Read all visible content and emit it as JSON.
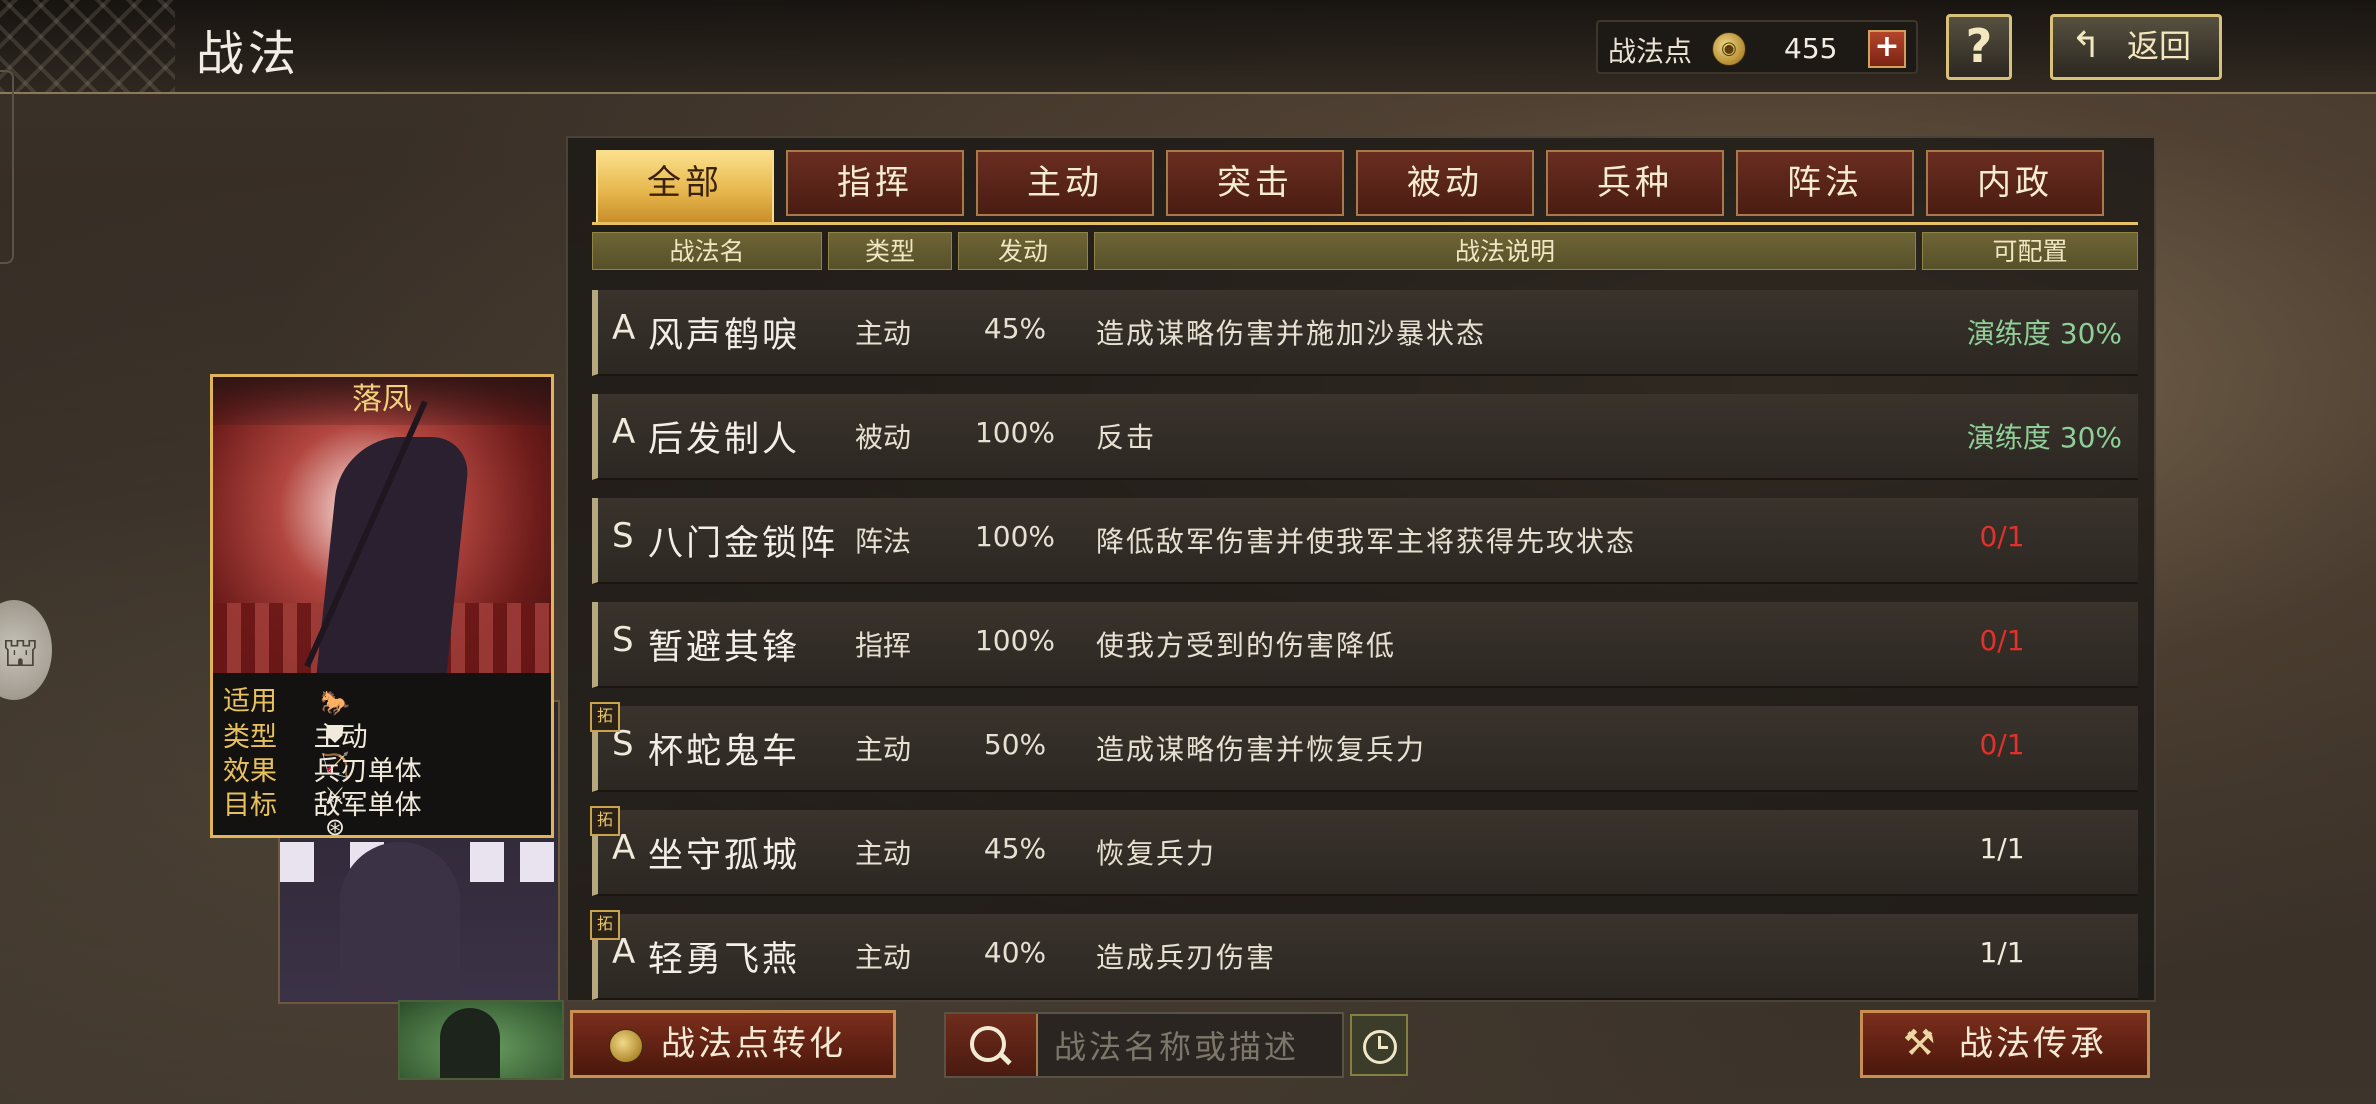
{
  "header": {
    "title": "战法",
    "points_label": "战法点",
    "points_value": "455",
    "plus_label": "+",
    "help_label": "?",
    "back_label": "返回"
  },
  "tabs": [
    {
      "label": "全部",
      "active": true
    },
    {
      "label": "指挥",
      "active": false
    },
    {
      "label": "主动",
      "active": false
    },
    {
      "label": "突击",
      "active": false
    },
    {
      "label": "被动",
      "active": false
    },
    {
      "label": "兵种",
      "active": false
    },
    {
      "label": "阵法",
      "active": false
    },
    {
      "label": "内政",
      "active": false
    }
  ],
  "columns": {
    "name": "战法名",
    "type": "类型",
    "rate": "发动",
    "desc": "战法说明",
    "config": "可配置"
  },
  "skills": [
    {
      "grade": "A",
      "name": "风声鹤唳",
      "type": "主动",
      "rate": "45%",
      "desc": "造成谋略伤害并施加沙暴状态",
      "config": "演练度 30%",
      "config_color": "green",
      "expand": ""
    },
    {
      "grade": "A",
      "name": "后发制人",
      "type": "被动",
      "rate": "100%",
      "desc": "反击",
      "config": "演练度 30%",
      "config_color": "green",
      "expand": ""
    },
    {
      "grade": "S",
      "name": "八门金锁阵",
      "type": "阵法",
      "rate": "100%",
      "desc": "降低敌军伤害并使我军主将获得先攻状态",
      "config": "0/1",
      "config_color": "red",
      "expand": ""
    },
    {
      "grade": "S",
      "name": "暂避其锋",
      "type": "指挥",
      "rate": "100%",
      "desc": "使我方受到的伤害降低",
      "config": "0/1",
      "config_color": "red",
      "expand": ""
    },
    {
      "grade": "S",
      "name": "杯蛇鬼车",
      "type": "主动",
      "rate": "50%",
      "desc": "造成谋略伤害并恢复兵力",
      "config": "0/1",
      "config_color": "red",
      "expand": "拓"
    },
    {
      "grade": "A",
      "name": "坐守孤城",
      "type": "主动",
      "rate": "45%",
      "desc": "恢复兵力",
      "config": "1/1",
      "config_color": "white",
      "expand": "拓"
    },
    {
      "grade": "A",
      "name": "轻勇飞燕",
      "type": "主动",
      "rate": "40%",
      "desc": "造成兵刃伤害",
      "config": "1/1",
      "config_color": "white",
      "expand": "拓"
    }
  ],
  "card": {
    "name": "落凤",
    "apply_label": "适用",
    "type_label": "类型",
    "type_value": "主动",
    "effect_label": "效果",
    "effect_value": "兵刃单体",
    "target_label": "目标",
    "target_value": "敌军单体",
    "troop_icons": [
      "cavalry-icon",
      "shield-icon",
      "bow-icon",
      "spear-icon",
      "wheel-icon"
    ]
  },
  "bottom": {
    "convert_label": "战法点转化",
    "search_placeholder": "战法名称或描述",
    "inherit_label": "战法传承"
  },
  "colors": {
    "accent_gold": "#e5b44a",
    "tab_red": "#6a2d20",
    "config_green": "#8fcf98",
    "config_red": "#e0312a"
  }
}
